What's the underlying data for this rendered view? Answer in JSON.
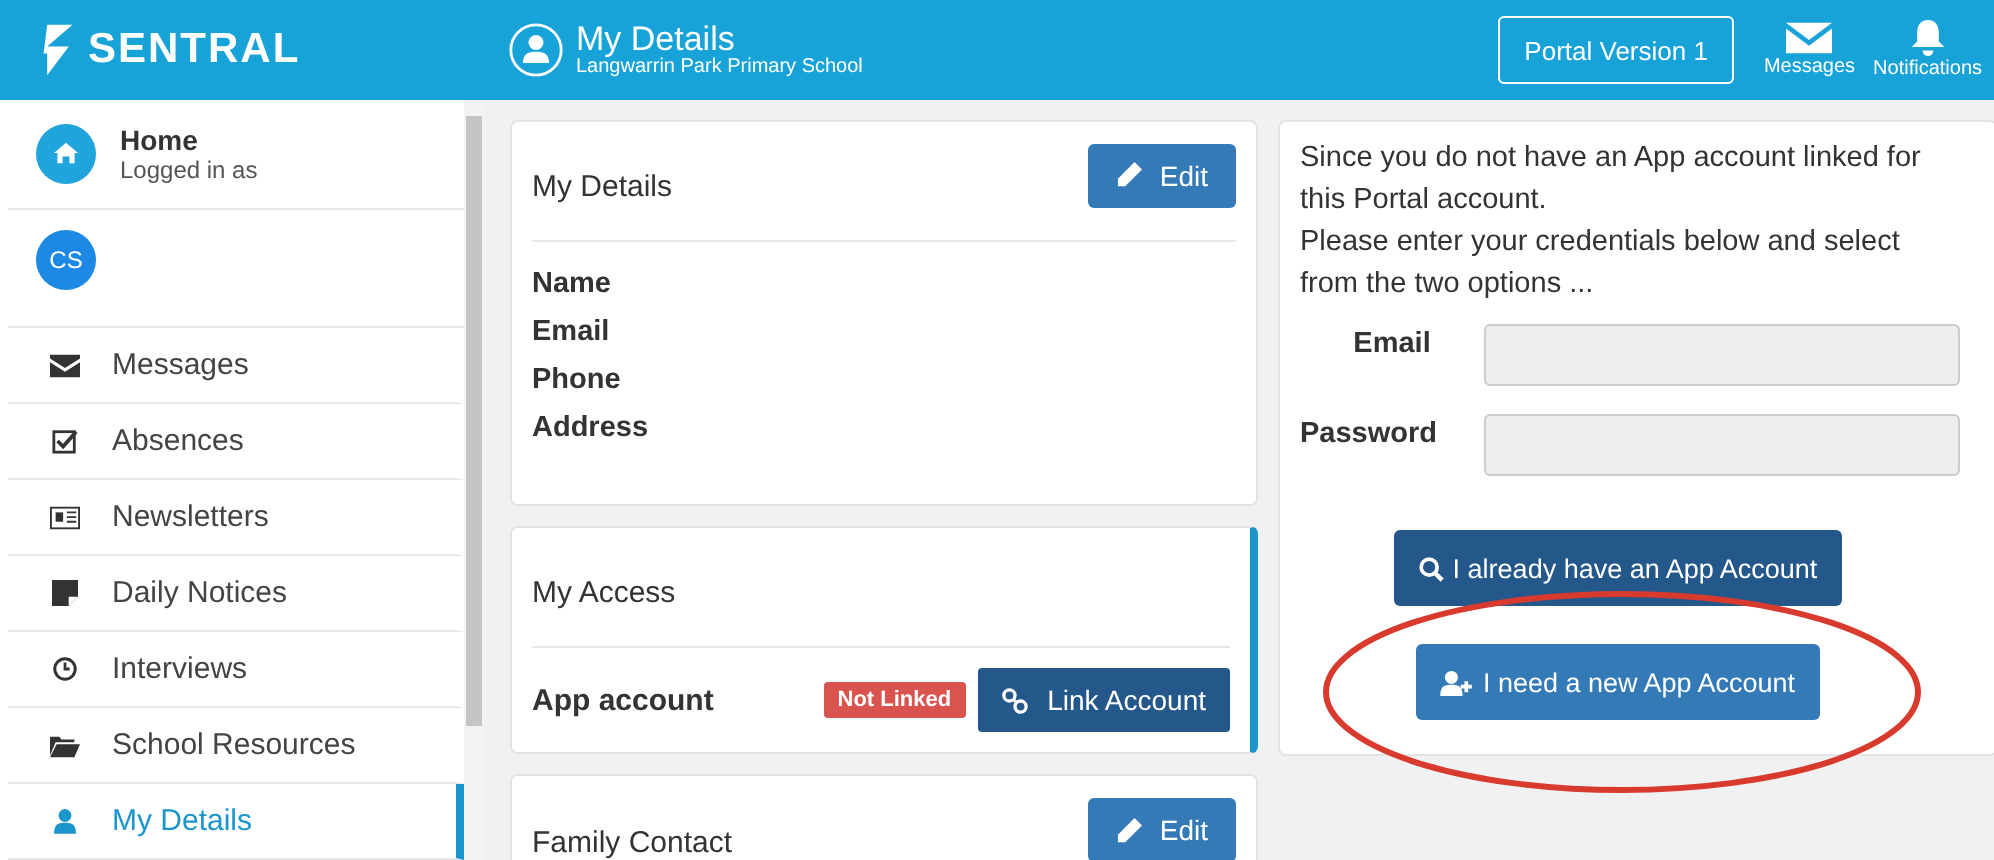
{
  "header": {
    "logo": "SENTRAL",
    "title": "My Details",
    "subtitle": "Langwarrin Park Primary School",
    "portal_button": "Portal Version 1",
    "actions": [
      {
        "label": "Messages"
      },
      {
        "label": "Notifications"
      }
    ]
  },
  "sidebar": {
    "home": {
      "title": "Home",
      "subtitle": "Logged in as"
    },
    "avatar": "CS",
    "items": [
      {
        "label": "Messages",
        "selected": false
      },
      {
        "label": "Absences",
        "selected": false
      },
      {
        "label": "Newsletters",
        "selected": false
      },
      {
        "label": "Daily Notices",
        "selected": false
      },
      {
        "label": "Interviews",
        "selected": false
      },
      {
        "label": "School Resources",
        "selected": false
      },
      {
        "label": "My Details",
        "selected": true
      }
    ]
  },
  "my_details": {
    "title": "My Details",
    "edit": "Edit",
    "fields": [
      "Name",
      "Email",
      "Phone",
      "Address"
    ]
  },
  "my_access": {
    "title": "My Access",
    "row_label": "App account",
    "badge": "Not Linked",
    "button": "Link Account"
  },
  "family_contact": {
    "title": "Family Contact",
    "edit": "Edit"
  },
  "link_panel": {
    "message": [
      "Since you do not have an App account linked for this Portal account.",
      "Please enter your credentials below and select from the two options ..."
    ],
    "fields": [
      {
        "label": "Email"
      },
      {
        "label": "Password"
      }
    ],
    "buttons": [
      {
        "kind": "existing",
        "label": "I already have an App Account"
      },
      {
        "kind": "new",
        "label": "I need a new App Account"
      }
    ]
  },
  "annotation": {
    "kind": "ellipse"
  }
}
